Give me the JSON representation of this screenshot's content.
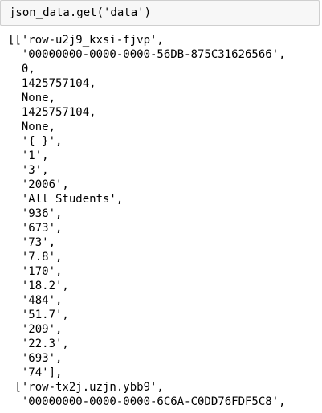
{
  "input_cell": {
    "code": "json_data.get('data')"
  },
  "output_cell": {
    "lines": [
      "[['row-u2j9_kxsi-fjvp',",
      "  '00000000-0000-0000-56DB-875C31626566',",
      "  0,",
      "  1425757104,",
      "  None,",
      "  1425757104,",
      "  None,",
      "  '{ }',",
      "  '1',",
      "  '3',",
      "  '2006',",
      "  'All Students',",
      "  '936',",
      "  '673',",
      "  '73',",
      "  '7.8',",
      "  '170',",
      "  '18.2',",
      "  '484',",
      "  '51.7',",
      "  '209',",
      "  '22.3',",
      "  '693',",
      "  '74'],",
      " ['row-tx2j.uzjn.ybb9',",
      "  '00000000-0000-0000-6C6A-C0DD76FDF5C8',"
    ]
  }
}
